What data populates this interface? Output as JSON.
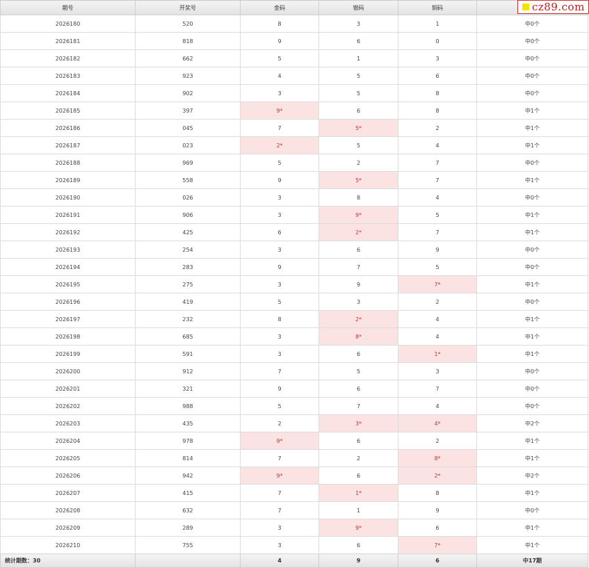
{
  "headers": [
    "期号",
    "开奖号",
    "金码",
    "银码",
    "铜码",
    ""
  ],
  "logo": "cz89.com",
  "rows": [
    {
      "period": "2026180",
      "draw": "520",
      "gold": "8",
      "silver": "3",
      "bronze": "1",
      "hits": "中0个",
      "gold_hit": false,
      "silver_hit": false,
      "bronze_hit": false
    },
    {
      "period": "2026181",
      "draw": "818",
      "gold": "9",
      "silver": "6",
      "bronze": "0",
      "hits": "中0个",
      "gold_hit": false,
      "silver_hit": false,
      "bronze_hit": false
    },
    {
      "period": "2026182",
      "draw": "662",
      "gold": "5",
      "silver": "1",
      "bronze": "3",
      "hits": "中0个",
      "gold_hit": false,
      "silver_hit": false,
      "bronze_hit": false
    },
    {
      "period": "2026183",
      "draw": "923",
      "gold": "4",
      "silver": "5",
      "bronze": "6",
      "hits": "中0个",
      "gold_hit": false,
      "silver_hit": false,
      "bronze_hit": false
    },
    {
      "period": "2026184",
      "draw": "902",
      "gold": "3",
      "silver": "5",
      "bronze": "8",
      "hits": "中0个",
      "gold_hit": false,
      "silver_hit": false,
      "bronze_hit": false
    },
    {
      "period": "2026185",
      "draw": "397",
      "gold": "9*",
      "silver": "6",
      "bronze": "8",
      "hits": "中1个",
      "gold_hit": true,
      "silver_hit": false,
      "bronze_hit": false
    },
    {
      "period": "2026186",
      "draw": "045",
      "gold": "7",
      "silver": "5*",
      "bronze": "2",
      "hits": "中1个",
      "gold_hit": false,
      "silver_hit": true,
      "bronze_hit": false
    },
    {
      "period": "2026187",
      "draw": "023",
      "gold": "2*",
      "silver": "5",
      "bronze": "4",
      "hits": "中1个",
      "gold_hit": true,
      "silver_hit": false,
      "bronze_hit": false
    },
    {
      "period": "2026188",
      "draw": "969",
      "gold": "5",
      "silver": "2",
      "bronze": "7",
      "hits": "中0个",
      "gold_hit": false,
      "silver_hit": false,
      "bronze_hit": false
    },
    {
      "period": "2026189",
      "draw": "558",
      "gold": "9",
      "silver": "5*",
      "bronze": "7",
      "hits": "中1个",
      "gold_hit": false,
      "silver_hit": true,
      "bronze_hit": false
    },
    {
      "period": "2026190",
      "draw": "026",
      "gold": "3",
      "silver": "8",
      "bronze": "4",
      "hits": "中0个",
      "gold_hit": false,
      "silver_hit": false,
      "bronze_hit": false
    },
    {
      "period": "2026191",
      "draw": "906",
      "gold": "3",
      "silver": "9*",
      "bronze": "5",
      "hits": "中1个",
      "gold_hit": false,
      "silver_hit": true,
      "bronze_hit": false
    },
    {
      "period": "2026192",
      "draw": "425",
      "gold": "6",
      "silver": "2*",
      "bronze": "7",
      "hits": "中1个",
      "gold_hit": false,
      "silver_hit": true,
      "bronze_hit": false
    },
    {
      "period": "2026193",
      "draw": "254",
      "gold": "3",
      "silver": "6",
      "bronze": "9",
      "hits": "中0个",
      "gold_hit": false,
      "silver_hit": false,
      "bronze_hit": false
    },
    {
      "period": "2026194",
      "draw": "283",
      "gold": "9",
      "silver": "7",
      "bronze": "5",
      "hits": "中0个",
      "gold_hit": false,
      "silver_hit": false,
      "bronze_hit": false
    },
    {
      "period": "2026195",
      "draw": "275",
      "gold": "3",
      "silver": "9",
      "bronze": "7*",
      "hits": "中1个",
      "gold_hit": false,
      "silver_hit": false,
      "bronze_hit": true
    },
    {
      "period": "2026196",
      "draw": "419",
      "gold": "5",
      "silver": "3",
      "bronze": "2",
      "hits": "中0个",
      "gold_hit": false,
      "silver_hit": false,
      "bronze_hit": false
    },
    {
      "period": "2026197",
      "draw": "232",
      "gold": "8",
      "silver": "2*",
      "bronze": "4",
      "hits": "中1个",
      "gold_hit": false,
      "silver_hit": true,
      "bronze_hit": false
    },
    {
      "period": "2026198",
      "draw": "685",
      "gold": "3",
      "silver": "8*",
      "bronze": "4",
      "hits": "中1个",
      "gold_hit": false,
      "silver_hit": true,
      "bronze_hit": false
    },
    {
      "period": "2026199",
      "draw": "591",
      "gold": "3",
      "silver": "6",
      "bronze": "1*",
      "hits": "中1个",
      "gold_hit": false,
      "silver_hit": false,
      "bronze_hit": true
    },
    {
      "period": "2026200",
      "draw": "912",
      "gold": "7",
      "silver": "5",
      "bronze": "3",
      "hits": "中0个",
      "gold_hit": false,
      "silver_hit": false,
      "bronze_hit": false
    },
    {
      "period": "2026201",
      "draw": "321",
      "gold": "9",
      "silver": "6",
      "bronze": "7",
      "hits": "中0个",
      "gold_hit": false,
      "silver_hit": false,
      "bronze_hit": false
    },
    {
      "period": "2026202",
      "draw": "988",
      "gold": "5",
      "silver": "7",
      "bronze": "4",
      "hits": "中0个",
      "gold_hit": false,
      "silver_hit": false,
      "bronze_hit": false
    },
    {
      "period": "2026203",
      "draw": "435",
      "gold": "2",
      "silver": "3*",
      "bronze": "4*",
      "hits": "中2个",
      "gold_hit": false,
      "silver_hit": true,
      "bronze_hit": true
    },
    {
      "period": "2026204",
      "draw": "978",
      "gold": "9*",
      "silver": "6",
      "bronze": "2",
      "hits": "中1个",
      "gold_hit": true,
      "silver_hit": false,
      "bronze_hit": false
    },
    {
      "period": "2026205",
      "draw": "814",
      "gold": "7",
      "silver": "2",
      "bronze": "8*",
      "hits": "中1个",
      "gold_hit": false,
      "silver_hit": false,
      "bronze_hit": true
    },
    {
      "period": "2026206",
      "draw": "942",
      "gold": "9*",
      "silver": "6",
      "bronze": "2*",
      "hits": "中2个",
      "gold_hit": true,
      "silver_hit": false,
      "bronze_hit": true
    },
    {
      "period": "2026207",
      "draw": "415",
      "gold": "7",
      "silver": "1*",
      "bronze": "8",
      "hits": "中1个",
      "gold_hit": false,
      "silver_hit": true,
      "bronze_hit": false
    },
    {
      "period": "2026208",
      "draw": "632",
      "gold": "7",
      "silver": "1",
      "bronze": "9",
      "hits": "中0个",
      "gold_hit": false,
      "silver_hit": false,
      "bronze_hit": false
    },
    {
      "period": "2026209",
      "draw": "289",
      "gold": "3",
      "silver": "9*",
      "bronze": "6",
      "hits": "中1个",
      "gold_hit": false,
      "silver_hit": true,
      "bronze_hit": false
    },
    {
      "period": "2026210",
      "draw": "755",
      "gold": "3",
      "silver": "6",
      "bronze": "7*",
      "hits": "中1个",
      "gold_hit": false,
      "silver_hit": false,
      "bronze_hit": true
    }
  ],
  "footer": {
    "count_label": "统计期数：30",
    "gold_total": "4",
    "silver_total": "9",
    "bronze_total": "6",
    "hit_total": "中17期"
  },
  "colors": {
    "hit_bg": "#fbe3e4",
    "hit_text": "#c0392b",
    "logo_red": "#c4161c",
    "logo_yellow": "#f5e400"
  }
}
